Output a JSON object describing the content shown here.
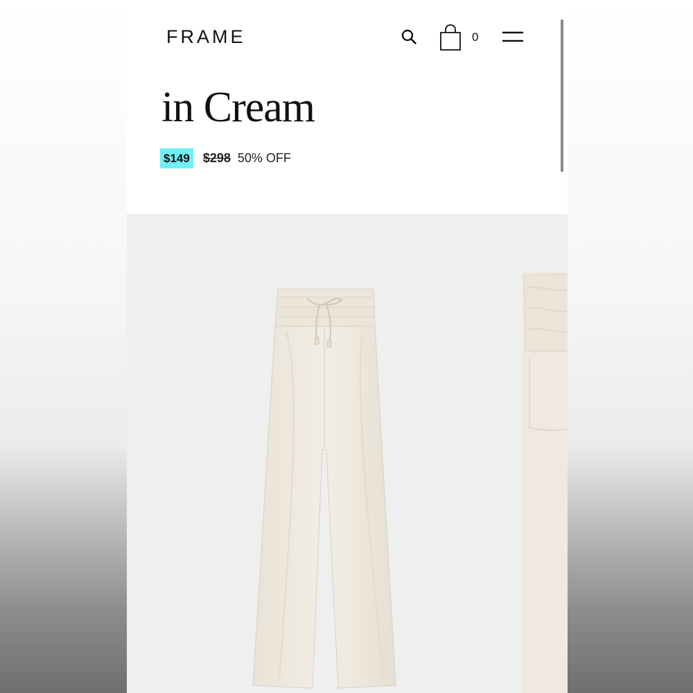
{
  "header": {
    "logo": "FRAME",
    "cart_count": "0",
    "icons": [
      "search-icon",
      "bag-icon",
      "menu-icon"
    ]
  },
  "product": {
    "title": "in Cream",
    "sale_price": "$149",
    "original_price": "$298",
    "discount": "50% OFF"
  },
  "colors": {
    "sale_highlight": "#6ff0f4",
    "gallery_bg": "#efefef",
    "text": "#111111"
  }
}
